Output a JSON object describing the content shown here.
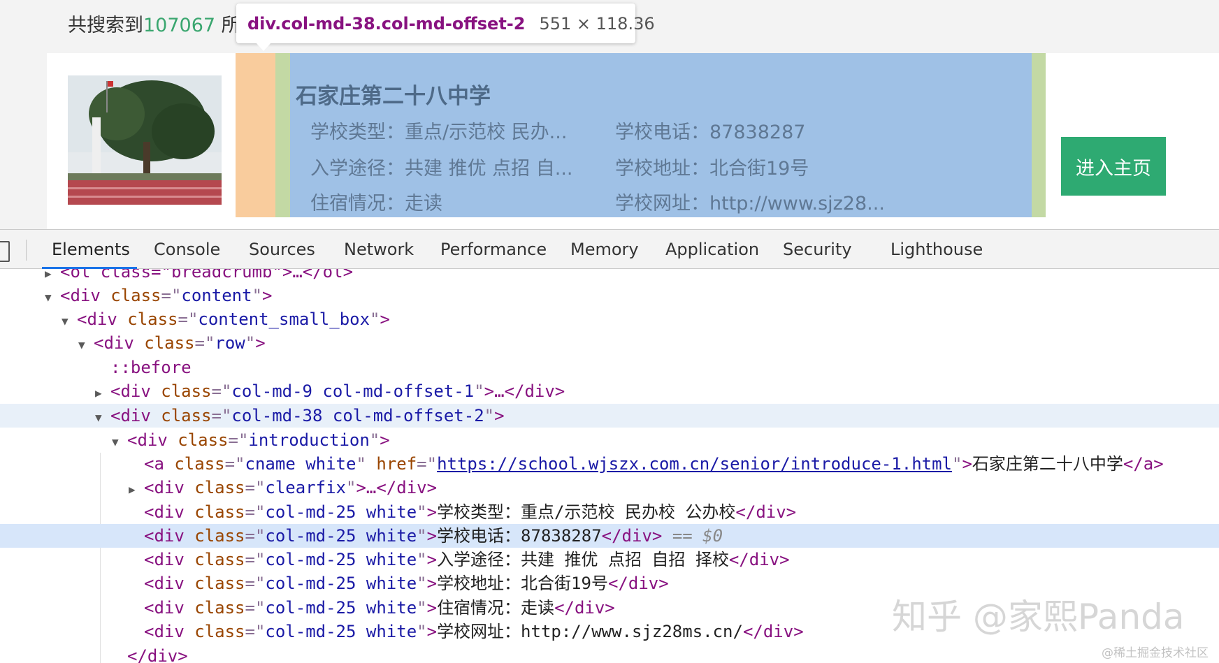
{
  "page": {
    "result_prefix": "共搜索到",
    "result_count": "107067",
    "result_suffix": " 所"
  },
  "tooltip": {
    "selector": "div.col-md-38.col-md-offset-2",
    "dimensions": "551 × 118.36"
  },
  "school": {
    "name": "石家庄第二十八中学",
    "type": "学校类型：重点/示范校 民办...",
    "phone": "学校电话：87838287",
    "admission": "入学途径：共建 推优 点招 自...",
    "address": "学校地址：北合街19号",
    "boarding": "住宿情况：走读",
    "website": "学校网址：http://www.sjz28...",
    "enter_button": "进入主页"
  },
  "devtools": {
    "tabs": [
      "Elements",
      "Console",
      "Sources",
      "Network",
      "Performance",
      "Memory",
      "Application",
      "Security",
      "Lighthouse"
    ],
    "active_tab": "Elements",
    "tree": {
      "line0": "<ol class=\"breadcrumb\">…</ol>",
      "content_div": "content",
      "small_box_div": "content_small_box",
      "row_div": "row",
      "before": "::before",
      "col9_div": "col-md-9 col-md-offset-1",
      "col38_div": "col-md-38 col-md-offset-2",
      "intro_div": "introduction",
      "a_class": "cname white",
      "a_href": "https://school.wjszx.com.cn/senior/introduce-1.html",
      "a_text": "石家庄第二十八中学",
      "clearfix_div": "clearfix",
      "col25_class": "col-md-25 white",
      "row_type": "学校类型：重点/示范校 民办校 公办校",
      "row_phone": "学校电话：87838287",
      "row_admission": "入学途径：共建 推优 点招 自招 择校",
      "row_address": "学校地址：北合街19号",
      "row_boarding": "住宿情况：走读",
      "row_website": "学校网址：http://www.sjz28ms.cn/",
      "eq_marker": "== $0",
      "close_div": "</div>"
    }
  },
  "watermarks": {
    "zhihu": "知乎 @家熙Panda",
    "juejin": "@稀土掘金技术社区"
  },
  "colors": {
    "accent_green": "#2eaa72",
    "highlight_content": "#9fc1e6",
    "highlight_padding": "#c3d9a4",
    "highlight_margin": "#f9cc9d",
    "tab_active": "#1a73e8"
  }
}
